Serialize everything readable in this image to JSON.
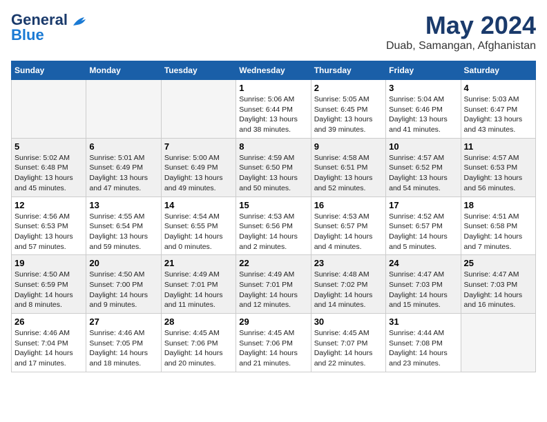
{
  "logo": {
    "line1": "General",
    "line2": "Blue"
  },
  "title": "May 2024",
  "location": "Duab, Samangan, Afghanistan",
  "days_header": [
    "Sunday",
    "Monday",
    "Tuesday",
    "Wednesday",
    "Thursday",
    "Friday",
    "Saturday"
  ],
  "weeks": [
    [
      {
        "num": "",
        "info": ""
      },
      {
        "num": "",
        "info": ""
      },
      {
        "num": "",
        "info": ""
      },
      {
        "num": "1",
        "info": "Sunrise: 5:06 AM\nSunset: 6:44 PM\nDaylight: 13 hours\nand 38 minutes."
      },
      {
        "num": "2",
        "info": "Sunrise: 5:05 AM\nSunset: 6:45 PM\nDaylight: 13 hours\nand 39 minutes."
      },
      {
        "num": "3",
        "info": "Sunrise: 5:04 AM\nSunset: 6:46 PM\nDaylight: 13 hours\nand 41 minutes."
      },
      {
        "num": "4",
        "info": "Sunrise: 5:03 AM\nSunset: 6:47 PM\nDaylight: 13 hours\nand 43 minutes."
      }
    ],
    [
      {
        "num": "5",
        "info": "Sunrise: 5:02 AM\nSunset: 6:48 PM\nDaylight: 13 hours\nand 45 minutes."
      },
      {
        "num": "6",
        "info": "Sunrise: 5:01 AM\nSunset: 6:49 PM\nDaylight: 13 hours\nand 47 minutes."
      },
      {
        "num": "7",
        "info": "Sunrise: 5:00 AM\nSunset: 6:49 PM\nDaylight: 13 hours\nand 49 minutes."
      },
      {
        "num": "8",
        "info": "Sunrise: 4:59 AM\nSunset: 6:50 PM\nDaylight: 13 hours\nand 50 minutes."
      },
      {
        "num": "9",
        "info": "Sunrise: 4:58 AM\nSunset: 6:51 PM\nDaylight: 13 hours\nand 52 minutes."
      },
      {
        "num": "10",
        "info": "Sunrise: 4:57 AM\nSunset: 6:52 PM\nDaylight: 13 hours\nand 54 minutes."
      },
      {
        "num": "11",
        "info": "Sunrise: 4:57 AM\nSunset: 6:53 PM\nDaylight: 13 hours\nand 56 minutes."
      }
    ],
    [
      {
        "num": "12",
        "info": "Sunrise: 4:56 AM\nSunset: 6:53 PM\nDaylight: 13 hours\nand 57 minutes."
      },
      {
        "num": "13",
        "info": "Sunrise: 4:55 AM\nSunset: 6:54 PM\nDaylight: 13 hours\nand 59 minutes."
      },
      {
        "num": "14",
        "info": "Sunrise: 4:54 AM\nSunset: 6:55 PM\nDaylight: 14 hours\nand 0 minutes."
      },
      {
        "num": "15",
        "info": "Sunrise: 4:53 AM\nSunset: 6:56 PM\nDaylight: 14 hours\nand 2 minutes."
      },
      {
        "num": "16",
        "info": "Sunrise: 4:53 AM\nSunset: 6:57 PM\nDaylight: 14 hours\nand 4 minutes."
      },
      {
        "num": "17",
        "info": "Sunrise: 4:52 AM\nSunset: 6:57 PM\nDaylight: 14 hours\nand 5 minutes."
      },
      {
        "num": "18",
        "info": "Sunrise: 4:51 AM\nSunset: 6:58 PM\nDaylight: 14 hours\nand 7 minutes."
      }
    ],
    [
      {
        "num": "19",
        "info": "Sunrise: 4:50 AM\nSunset: 6:59 PM\nDaylight: 14 hours\nand 8 minutes."
      },
      {
        "num": "20",
        "info": "Sunrise: 4:50 AM\nSunset: 7:00 PM\nDaylight: 14 hours\nand 9 minutes."
      },
      {
        "num": "21",
        "info": "Sunrise: 4:49 AM\nSunset: 7:01 PM\nDaylight: 14 hours\nand 11 minutes."
      },
      {
        "num": "22",
        "info": "Sunrise: 4:49 AM\nSunset: 7:01 PM\nDaylight: 14 hours\nand 12 minutes."
      },
      {
        "num": "23",
        "info": "Sunrise: 4:48 AM\nSunset: 7:02 PM\nDaylight: 14 hours\nand 14 minutes."
      },
      {
        "num": "24",
        "info": "Sunrise: 4:47 AM\nSunset: 7:03 PM\nDaylight: 14 hours\nand 15 minutes."
      },
      {
        "num": "25",
        "info": "Sunrise: 4:47 AM\nSunset: 7:03 PM\nDaylight: 14 hours\nand 16 minutes."
      }
    ],
    [
      {
        "num": "26",
        "info": "Sunrise: 4:46 AM\nSunset: 7:04 PM\nDaylight: 14 hours\nand 17 minutes."
      },
      {
        "num": "27",
        "info": "Sunrise: 4:46 AM\nSunset: 7:05 PM\nDaylight: 14 hours\nand 18 minutes."
      },
      {
        "num": "28",
        "info": "Sunrise: 4:45 AM\nSunset: 7:06 PM\nDaylight: 14 hours\nand 20 minutes."
      },
      {
        "num": "29",
        "info": "Sunrise: 4:45 AM\nSunset: 7:06 PM\nDaylight: 14 hours\nand 21 minutes."
      },
      {
        "num": "30",
        "info": "Sunrise: 4:45 AM\nSunset: 7:07 PM\nDaylight: 14 hours\nand 22 minutes."
      },
      {
        "num": "31",
        "info": "Sunrise: 4:44 AM\nSunset: 7:08 PM\nDaylight: 14 hours\nand 23 minutes."
      },
      {
        "num": "",
        "info": ""
      }
    ]
  ]
}
